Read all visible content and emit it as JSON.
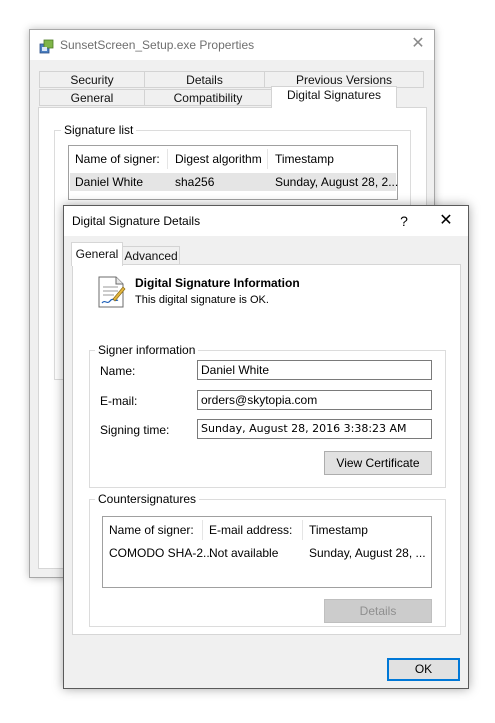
{
  "properties_window": {
    "title": "SunsetScreen_Setup.exe Properties",
    "close_glyph": "✕",
    "tabs_row1": [
      "Security",
      "Details",
      "Previous Versions"
    ],
    "tabs_row2": [
      "General",
      "Compatibility",
      "Digital Signatures"
    ],
    "selected_tab": "Digital Signatures",
    "signature_list": {
      "group_label": "Signature list",
      "columns": [
        "Name of signer:",
        "Digest algorithm",
        "Timestamp"
      ],
      "rows": [
        {
          "name": "Daniel White",
          "digest": "sha256",
          "timestamp": "Sunday, August 28, 2..."
        }
      ]
    }
  },
  "details_dialog": {
    "title": "Digital Signature Details",
    "help_glyph": "?",
    "close_glyph": "✕",
    "tabs": [
      "General",
      "Advanced"
    ],
    "selected_tab": "General",
    "info": {
      "heading": "Digital Signature Information",
      "status": "This digital signature is OK."
    },
    "signer": {
      "group_label": "Signer information",
      "name_label": "Name:",
      "name_value": "Daniel White",
      "email_label": "E-mail:",
      "email_value": "orders@skytopia.com",
      "time_label": "Signing time:",
      "time_value": "Sunday, August 28, 2016 3:38:23 AM",
      "view_cert_label": "View Certificate"
    },
    "countersignatures": {
      "group_label": "Countersignatures",
      "columns": [
        "Name of signer:",
        "E-mail address:",
        "Timestamp"
      ],
      "rows": [
        {
          "name": "COMODO SHA-2...",
          "email": "Not available",
          "timestamp": "Sunday, August 28, ..."
        }
      ],
      "details_label": "Details"
    },
    "ok_label": "OK"
  },
  "colors": {
    "accent": "#0078d7",
    "window_bg": "#f0f0f0",
    "selection_row": "#e5e5e5"
  }
}
